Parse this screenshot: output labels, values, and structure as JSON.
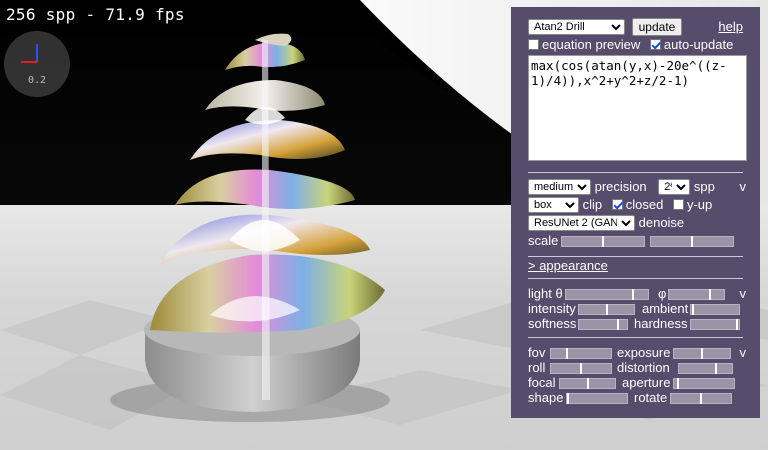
{
  "status": {
    "fps_text": "256 spp - 71.9 fps",
    "scale_text": "0.2"
  },
  "panel": {
    "preset_selected": "Atan2 Drill",
    "update_label": "update",
    "help_label": "help",
    "equation_preview_label": "equation preview",
    "equation_preview_checked": false,
    "auto_update_label": "auto-update",
    "auto_update_checked": true,
    "expression": "max(cos(atan(y,x)-20e^((z-1)/4)),x^2+y^2+z/2-1)",
    "quality": {
      "precision_selected": "medium",
      "precision_label": "precision",
      "spp_selected": "2ª",
      "spp_label": "spp",
      "toggle_label": "v",
      "clip_selected": "box",
      "clip_label": "clip",
      "closed_label": "closed",
      "closed_checked": true,
      "yup_label": "y-up",
      "yup_checked": false,
      "denoise_selected": "ResUNet 2 (GAN)",
      "denoise_label": "denoise",
      "scale_label": "scale",
      "scale_slider_1": 0.5,
      "scale_slider_2": 0.5
    },
    "appearance_label": "> appearance",
    "lighting": {
      "light_label": "light θ",
      "phi_label": "φ",
      "toggle_label": "v",
      "theta_value": 0.82,
      "phi_value": 0.75,
      "intensity_label": "intensity",
      "intensity_value": 0.5,
      "ambient_label": "ambient",
      "ambient_value": 0.02,
      "softness_label": "softness",
      "softness_value": 0.82,
      "hardness_label": "hardness",
      "hardness_value": 0.98
    },
    "camera": {
      "fov_label": "fov",
      "fov_value": 0.25,
      "exposure_label": "exposure",
      "exposure_value": 0.5,
      "toggle_label": "v",
      "roll_label": "roll",
      "roll_value": 0.5,
      "distortion_label": "distortion",
      "distortion_value": 0.7,
      "focal_label": "focal",
      "focal_value": 0.5,
      "aperture_label": "aperture",
      "aperture_value": 0.05,
      "shape_label": "shape",
      "shape_value": 0.0,
      "rotate_label": "rotate",
      "rotate_value": 0.5
    }
  },
  "colors": {
    "panel_bg": "#564c6b",
    "slider_track": "#9a94a6",
    "axis_x": "#e02020",
    "axis_y": "#3050ff"
  }
}
